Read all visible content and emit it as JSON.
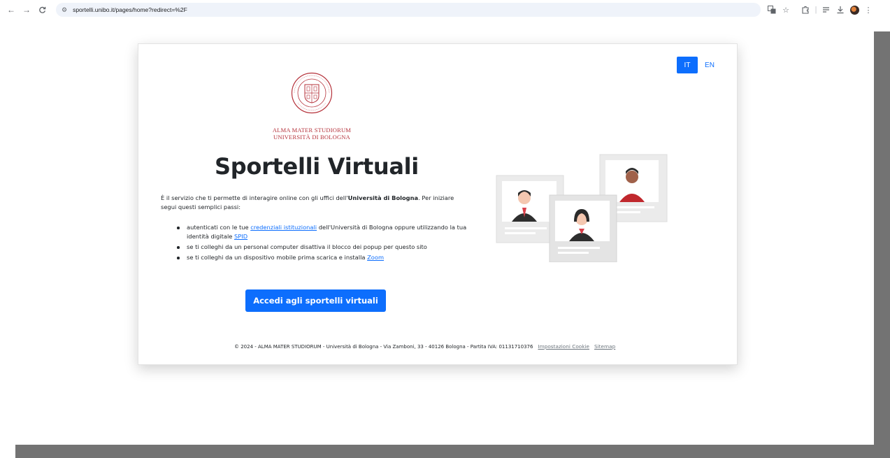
{
  "browser": {
    "url": "sportelli.unibo.it/pages/home?redirect=%2F",
    "nav": {
      "back_icon": "arrow-left-icon",
      "forward_icon": "arrow-right-icon",
      "reload_icon": "reload-icon",
      "site_info_icon": "tune-icon"
    },
    "toolbar_icons": [
      "translate-icon",
      "star-icon",
      "extensions-icon",
      "reading-list-icon",
      "download-icon",
      "profile-avatar",
      "more-menu-icon"
    ]
  },
  "header": {
    "lang_it": "IT",
    "lang_en": "EN"
  },
  "logo": {
    "seal_text_top": "ALMA MATER STUDIORUM",
    "seal_year": "A.D. 1088",
    "line1": "ALMA MATER STUDIORUM",
    "line2": "UNIVERSITÀ DI BOLOGNA"
  },
  "main": {
    "title": "Sportelli Virtuali",
    "intro_prefix": "È il servizio che ti permette di interagire online con gli uffici dell'",
    "intro_bold": "Università di Bologna",
    "intro_suffix": ". Per iniziare segui questi semplici passi:",
    "step1_prefix": "autenticati con le tue ",
    "step1_link": "credenziali istituzionali",
    "step1_middle": " dell'Università di Bologna oppure utilizzando la tua identità digitale ",
    "step1_link2": "SPID",
    "step2": "se ti colleghi da un personal computer disattiva il blocco dei popup per questo sito",
    "step3_prefix": "se ti colleghi da un dispositivo mobile prima scarica e installa ",
    "step3_link": "Zoom",
    "cta_label": "Accedi agli sportelli virtuali"
  },
  "footer": {
    "copyright": "© 2024 - ALMA MATER STUDIORUM - Università di Bologna - Via Zamboni, 33 - 40126 Bologna - Partita IVA: 01131710376",
    "cookie_link": "Impostazioni Cookie",
    "sitemap_link": "Sitemap"
  },
  "colors": {
    "primary": "#0d6efd",
    "brand_red": "#b5313a",
    "text": "#212529"
  }
}
